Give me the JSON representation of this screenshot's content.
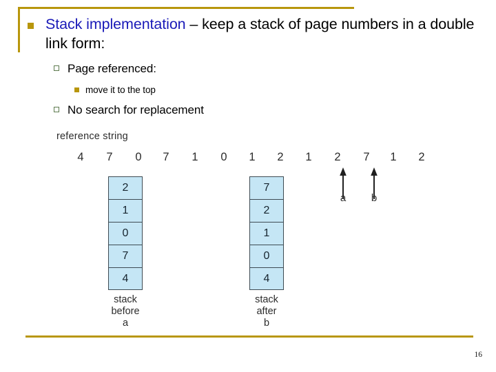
{
  "slide": {
    "page_number": "16",
    "accent_color": "#b8960c",
    "title_highlight_color": "#1a1ab8",
    "cell_fill_color": "#c5e6f5"
  },
  "title": {
    "emphasis": "Stack implementation",
    "rest": " – keep a stack of page numbers in a double link form:"
  },
  "bullets": [
    {
      "level": 2,
      "text": "Page referenced:"
    },
    {
      "level": 3,
      "text": "move it to the top"
    },
    {
      "level": 2,
      "text": "No search for replacement"
    }
  ],
  "figure": {
    "reference_string_label": "reference string",
    "reference_string": [
      "4",
      "7",
      "0",
      "7",
      "1",
      "0",
      "1",
      "2",
      "1",
      "2",
      "7",
      "1",
      "2"
    ],
    "pointers": [
      {
        "label": "a",
        "points_to_index": 9
      },
      {
        "label": "b",
        "points_to_index": 10
      }
    ],
    "stacks": [
      {
        "name": "stack-before",
        "cells": [
          "2",
          "1",
          "0",
          "7",
          "4"
        ],
        "caption_line1": "stack",
        "caption_line2": "before",
        "caption_line3": "a"
      },
      {
        "name": "stack-after",
        "cells": [
          "7",
          "2",
          "1",
          "0",
          "4"
        ],
        "caption_line1": "stack",
        "caption_line2": "after",
        "caption_line3": "b"
      }
    ]
  }
}
